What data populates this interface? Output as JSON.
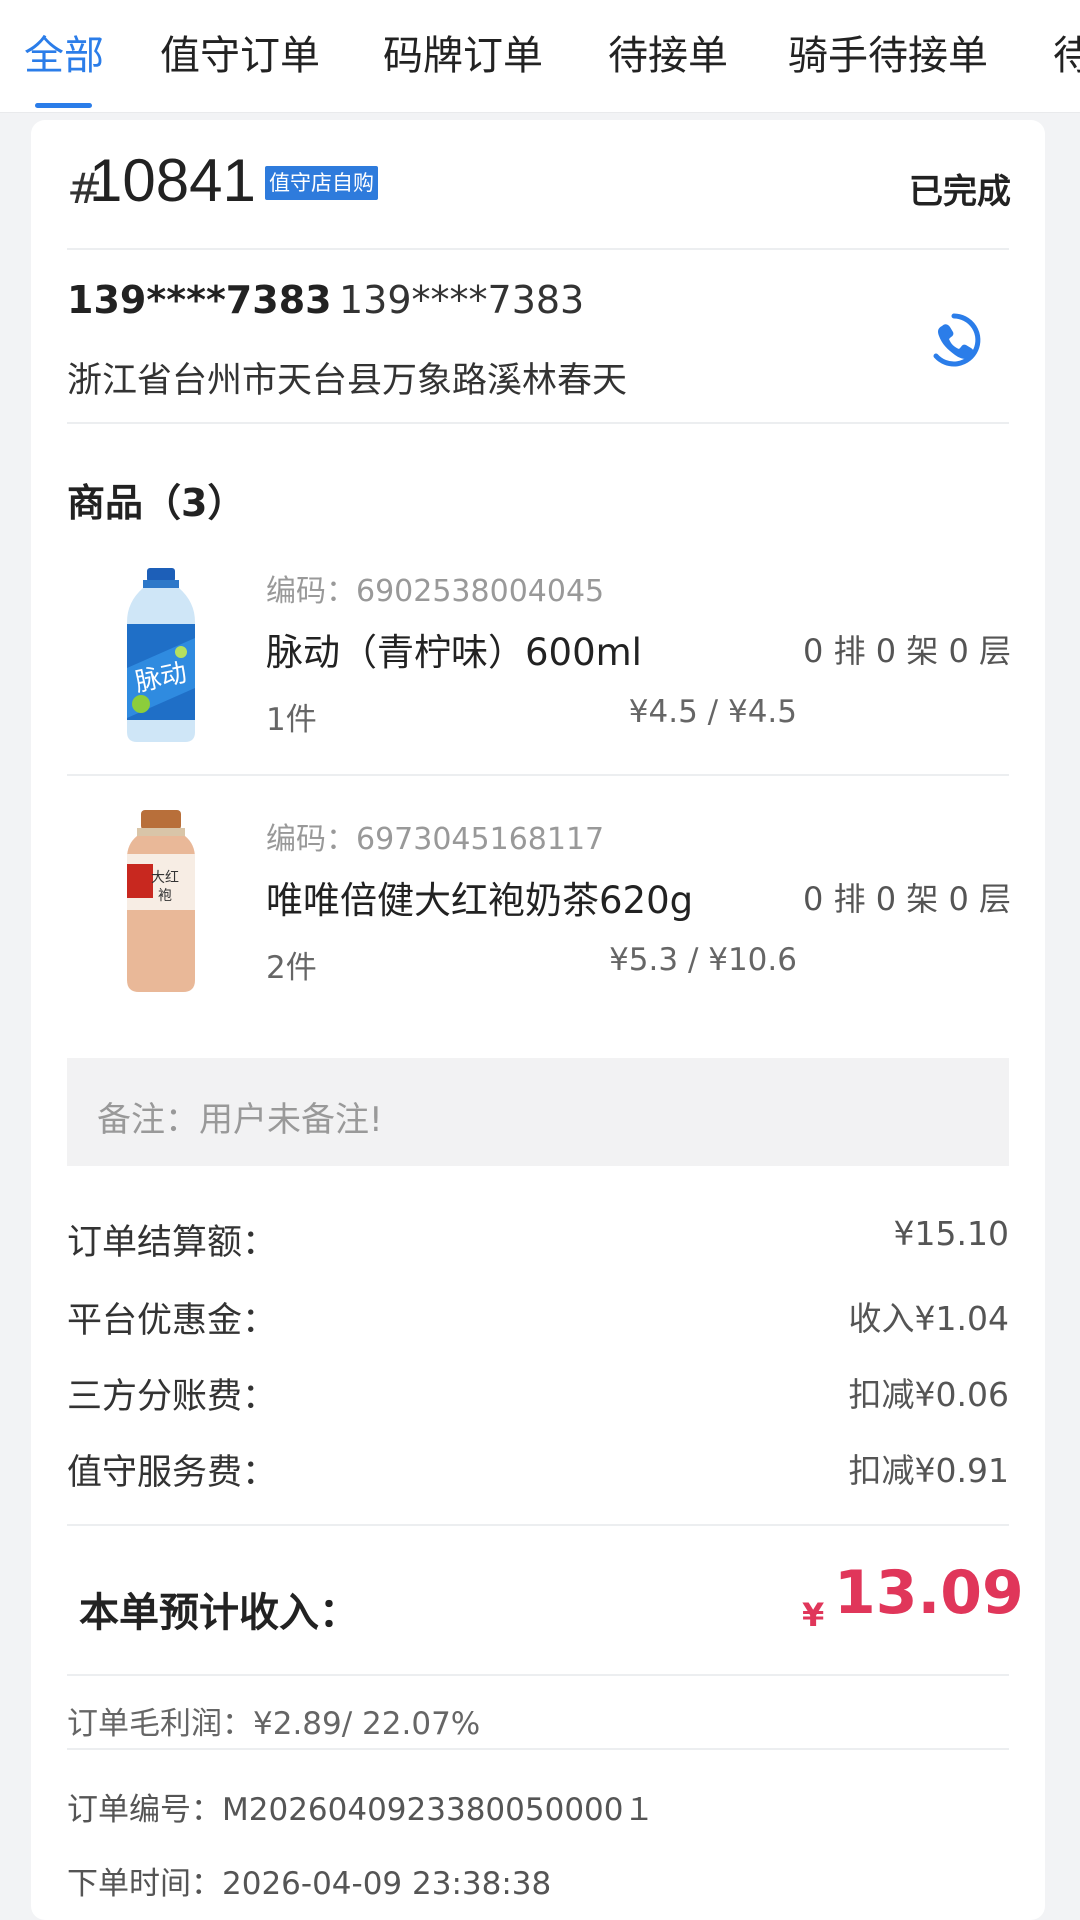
{
  "tabs": [
    "全部",
    "值守订单",
    "码牌订单",
    "待接单",
    "骑手待接单",
    "待"
  ],
  "order": {
    "hash": "#",
    "number": "10841",
    "tag": "值守店自购",
    "status": "已完成"
  },
  "customer": {
    "name_masked": "139****7383",
    "phone_masked": "139****7383",
    "address": "浙江省台州市天台县万象路溪林春天"
  },
  "goods": {
    "title": "商品（3）",
    "items": [
      {
        "code": "编码：6902538004045",
        "name": "脉动（青柠味）600ml",
        "location": "0 排 0 架 0 层",
        "quantity": "1件",
        "price": "¥4.5 / ¥4.5"
      },
      {
        "code": "编码：6973045168117",
        "name": "唯唯倍健大红袍奶茶620g",
        "location": "0 排 0 架 0 层",
        "quantity": "2件",
        "price": "¥5.3 / ¥10.6"
      }
    ]
  },
  "remark": "备注：用户未备注!",
  "fees": [
    {
      "label": "订单结算额：",
      "value": "¥15.10"
    },
    {
      "label": "平台优惠金：",
      "value": "收入¥1.04"
    },
    {
      "label": "三方分账费：",
      "value": "扣减¥0.06"
    },
    {
      "label": "值守服务费：",
      "value": "扣减¥0.91"
    }
  ],
  "income": {
    "label": "本单预计收入：",
    "currency": "¥",
    "value": "13.09"
  },
  "profit": "订单毛利润：¥2.89/ 22.07%",
  "order_info": {
    "serial": "订单编号：M2026040923380050000１",
    "time": "下单时间：2026-04-09 23:38:38"
  },
  "colors": {
    "accent": "#2b7de9",
    "income": "#e0365a",
    "tag_bg": "#2e7bdc"
  },
  "icons": [
    "phone-icon",
    "product-image-maidong",
    "product-image-milk-tea"
  ]
}
